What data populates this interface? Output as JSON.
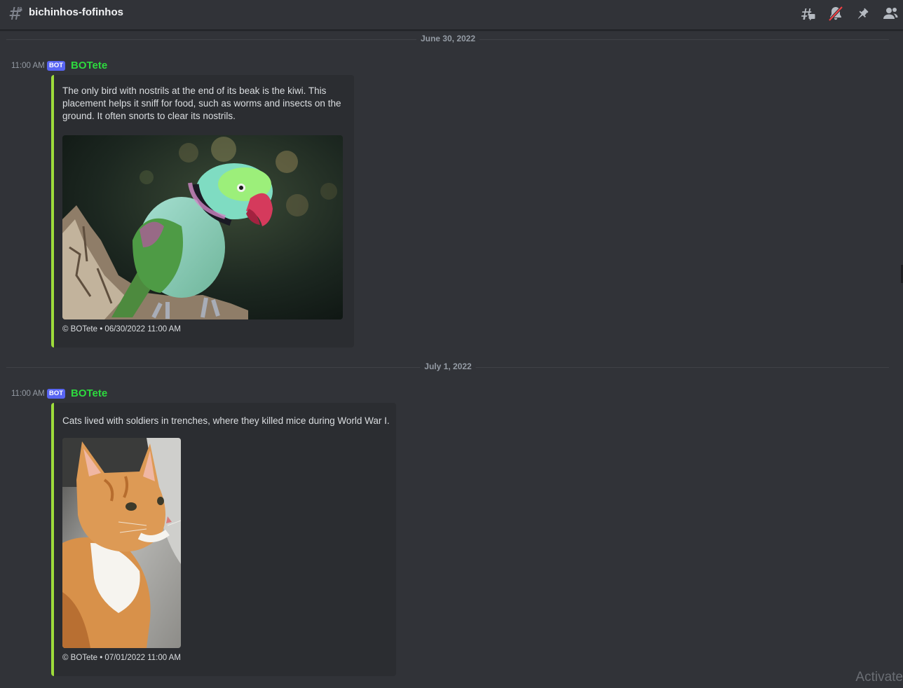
{
  "header": {
    "channel_name": "bichinhos-fofinhos",
    "icons": [
      "threads-icon",
      "notifications-muted-icon",
      "pinned-messages-icon",
      "member-list-icon"
    ]
  },
  "colors": {
    "background": "#313338",
    "embed_background": "#2b2d31",
    "embed_accent": "#9ddc3b",
    "bot_tag": "#5865f2",
    "author_name": "#2dda3e",
    "muted_slash": "#f23f43"
  },
  "messages": [
    {
      "date_divider": "June 30, 2022",
      "time": "11:00 AM",
      "bot_tag": "BOT",
      "author": "BOTete",
      "embed": {
        "description": "The only bird with nostrils at the end of its beak is the kiwi. This placement helps it sniff for food, such as worms and insects on the ground. It often snorts to clear its nostrils.",
        "image_alt": "parrot-photo",
        "footer": "© BOTete • 06/30/2022 11:00 AM"
      }
    },
    {
      "date_divider": "July 1, 2022",
      "time": "11:00 AM",
      "bot_tag": "BOT",
      "author": "BOTete",
      "embed": {
        "description": "Cats lived with soldiers in trenches, where they killed mice during World War I.",
        "image_alt": "cat-photo",
        "footer": "© BOTete • 07/01/2022 11:00 AM"
      }
    }
  ],
  "watermark": "Activate"
}
